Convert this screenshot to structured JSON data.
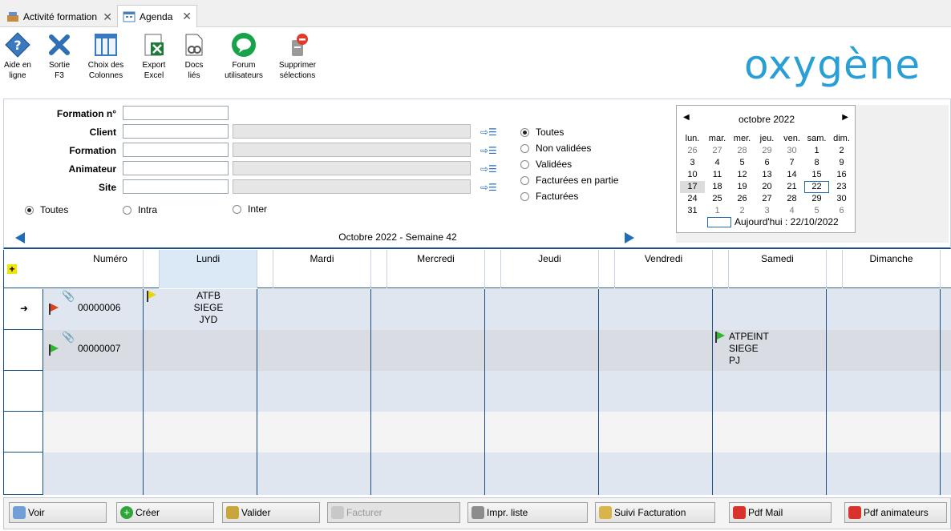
{
  "tabs": [
    {
      "label": "Activité formation",
      "icon": "training-icon"
    },
    {
      "label": "Agenda",
      "icon": "agenda-icon"
    }
  ],
  "toolbar": {
    "items": [
      {
        "label": "Aide en ligne",
        "icon": "help-icon"
      },
      {
        "label": "Sortie F3",
        "icon": "exit-icon"
      },
      {
        "label": "Choix des Colonnes",
        "icon": "columns-icon"
      },
      {
        "label": "Export Excel",
        "icon": "excel-icon"
      },
      {
        "label": "Docs liés",
        "icon": "documents-icon"
      },
      {
        "label": "Forum utilisateurs",
        "icon": "forum-icon"
      },
      {
        "label": "Supprimer sélections",
        "icon": "delete-selection-icon"
      }
    ],
    "logo": "oxygène"
  },
  "filters": {
    "labels": {
      "formation_no": "Formation n°",
      "client": "Client",
      "formation": "Formation",
      "animateur": "Animateur",
      "site": "Site"
    },
    "values": {
      "formation_no": "",
      "client": "",
      "client_desc": "",
      "formation": "",
      "formation_desc": "",
      "animateur": "",
      "animateur_desc": "",
      "site": "",
      "site_desc": ""
    },
    "type_options": [
      "Toutes",
      "Intra",
      "Inter"
    ],
    "type_selected": "Toutes",
    "status_options": [
      "Toutes",
      "Non validées",
      "Validées",
      "Facturées en partie",
      "Facturées"
    ],
    "status_selected": "Toutes",
    "week_label": "Octobre 2022 - Semaine 42"
  },
  "calendar": {
    "month_label": "octobre 2022",
    "day_names": [
      "lun.",
      "mar.",
      "mer.",
      "jeu.",
      "ven.",
      "sam.",
      "dim."
    ],
    "weeks": [
      [
        "26",
        "27",
        "28",
        "29",
        "30",
        "1",
        "2"
      ],
      [
        "3",
        "4",
        "5",
        "6",
        "7",
        "8",
        "9"
      ],
      [
        "10",
        "11",
        "12",
        "13",
        "14",
        "15",
        "16"
      ],
      [
        "17",
        "18",
        "19",
        "20",
        "21",
        "22",
        "23"
      ],
      [
        "24",
        "25",
        "26",
        "27",
        "28",
        "29",
        "30"
      ],
      [
        "31",
        "1",
        "2",
        "3",
        "4",
        "5",
        "6"
      ]
    ],
    "selected_day": "17",
    "today_day": "22",
    "today_label": "Aujourd'hui : 22/10/2022"
  },
  "agenda": {
    "columns": [
      "Numéro",
      "Lundi",
      "Mardi",
      "Mercredi",
      "Jeudi",
      "Vendredi",
      "Samedi",
      "Dimanche"
    ],
    "highlighted_column": "Lundi",
    "rows": [
      {
        "numero": "00000006",
        "flag_color": "#d9431e",
        "current": true,
        "has_attachment": true,
        "event": {
          "day": "Lundi",
          "lines": [
            "ATFB",
            "SIEGE",
            "JYD"
          ],
          "flag_color": "#e8d800"
        }
      },
      {
        "numero": "00000007",
        "flag_color": "#2fb52f",
        "current": false,
        "has_attachment": true,
        "event": {
          "day": "Samedi",
          "lines": [
            "ATPEINT",
            "SIEGE",
            "PJ"
          ],
          "flag_color": "#2fb52f"
        }
      }
    ]
  },
  "actions": [
    {
      "label": "Voir",
      "icon": "view-icon",
      "enabled": true
    },
    {
      "label": "Créer",
      "icon": "create-icon",
      "enabled": true
    },
    {
      "label": "Valider",
      "icon": "validate-icon",
      "enabled": true
    },
    {
      "label": "Facturer",
      "icon": "invoice-icon",
      "enabled": false
    },
    {
      "label": "Impr. liste",
      "icon": "print-icon",
      "enabled": true
    },
    {
      "label": "Suivi Facturation",
      "icon": "billing-tracking-icon",
      "enabled": true
    },
    {
      "label": "Pdf Mail",
      "icon": "pdf-icon",
      "enabled": true
    },
    {
      "label": "Pdf animateurs",
      "icon": "pdf-icon",
      "enabled": true
    }
  ],
  "colors": {
    "accent": "#1a4f86",
    "logo": "#2a9fd6",
    "row_grey": "#d9dde3",
    "row_light": "#f4f4f4",
    "row_blue": "#dfe6ef"
  }
}
